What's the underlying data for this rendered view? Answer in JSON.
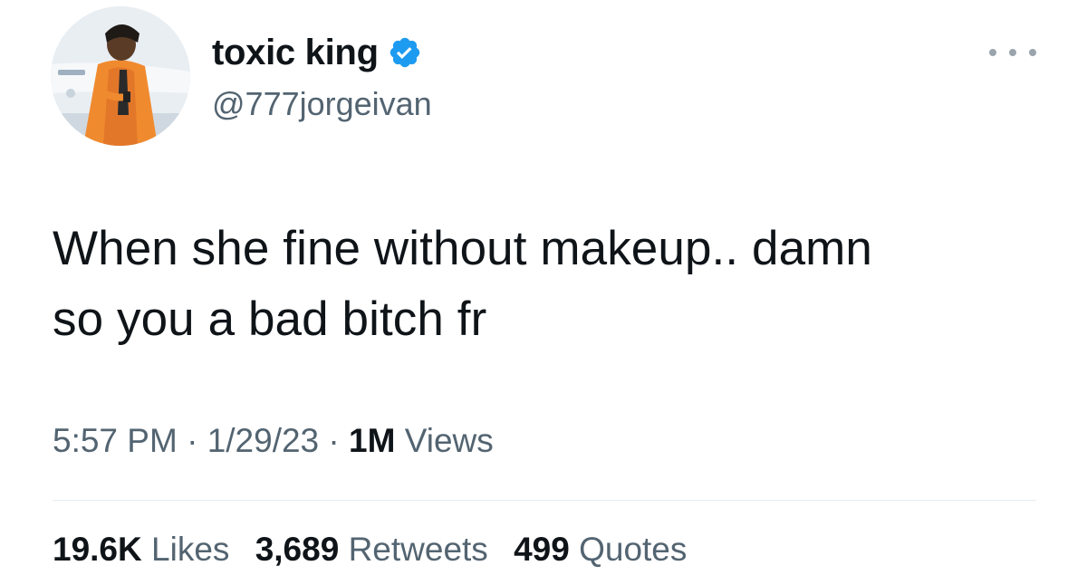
{
  "author": {
    "display_name": "toxic king",
    "handle": "@777jorgeivan",
    "verified": true,
    "verified_icon": "verified-badge-icon",
    "verified_color": "#1d9bf0"
  },
  "tweet": {
    "text_line_1": "When she fine without makeup.. damn",
    "text_line_2": "so you a bad bitch fr"
  },
  "meta": {
    "time": "5:57 PM",
    "separator": "·",
    "date": "1/29/23",
    "views_count": "1M",
    "views_label": "Views"
  },
  "stats": {
    "likes_count": "19.6K",
    "likes_label": "Likes",
    "retweets_count": "3,689",
    "retweets_label": "Retweets",
    "quotes_count": "499",
    "quotes_label": "Quotes"
  },
  "colors": {
    "text_primary": "#0f1419",
    "text_secondary": "#536471",
    "divider": "#e6ecf0"
  }
}
